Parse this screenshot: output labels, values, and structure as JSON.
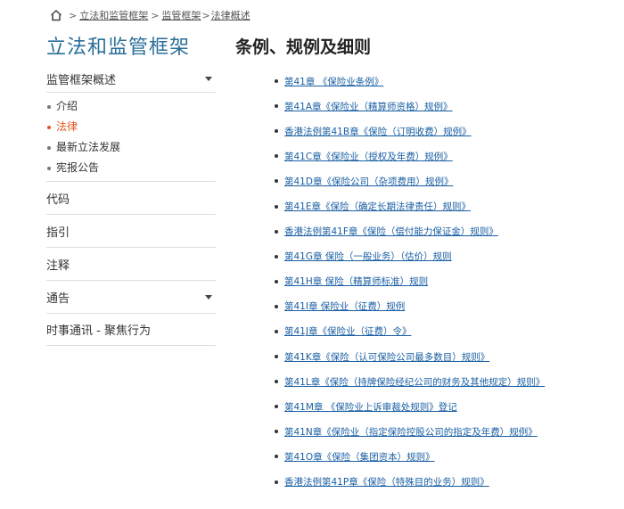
{
  "breadcrumb": {
    "sep1": ">",
    "link1": "立法和监管框架",
    "sep2": ">",
    "link2": "监管框架",
    "sep3": ">",
    "current": "法律概述"
  },
  "sidebar": {
    "title": "立法和监管框架",
    "section": {
      "label": "监管框架概述",
      "items": [
        {
          "label": "介绍"
        },
        {
          "label": "法律"
        },
        {
          "label": "最新立法发展"
        },
        {
          "label": "宪报公告"
        }
      ]
    },
    "nav": [
      {
        "label": "代码"
      },
      {
        "label": "指引"
      },
      {
        "label": "注释"
      },
      {
        "label": "通告"
      },
      {
        "label": "时事通讯 - 聚焦行为"
      }
    ]
  },
  "main": {
    "title": "条例、规例及细则",
    "items": [
      "第41章 《保险业条例》",
      "第41A章《保险业（精算师资格）规例》",
      "香港法例第41B章《保险（订明收费）规例》",
      "第41C章《保险业（授权及年费）规例》",
      "第41D章《保险公司（杂项费用）规例》",
      "第41E章《保险（确定长期法律责任）规则》",
      "香港法例第41F章《保险（偿付能力保证金）规则》",
      "第41G章 保险（一般业务）（估价）规则",
      "第41H章 保险（精算师标准）规则",
      "第41I章 保险业（征费）规例",
      "第41J章《保险业（征费）令》",
      "第41K章《保险（认可保险公司最多数目）规则》",
      "第41L章《保险（持牌保险经纪公司的财务及其他规定）规则》",
      "第41M章 《保险业上诉审裁处规则》登记",
      "第41N章《保险业（指定保险控股公司的指定及年费）规例》",
      "第41O章《保险（集团资本）规则》",
      "香港法例第41P章《保险（特殊目的业务）规则》"
    ]
  }
}
